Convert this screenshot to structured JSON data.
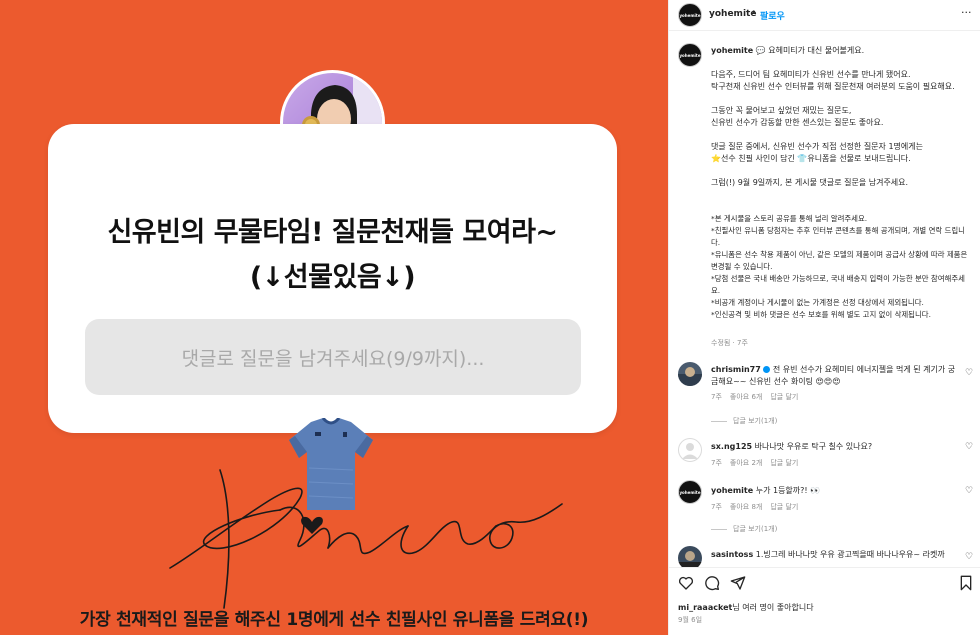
{
  "colors": {
    "background_orange": "#ec5a2e",
    "link_blue": "#0095f6",
    "muted": "#8e8e8e"
  },
  "image": {
    "card_title_line1": "신유빈의 무물타임! 질문천재들 모여라~",
    "card_title_line2": "(↓선물있음↓)",
    "card_input_placeholder": "댓글로 질문을 남겨주세요(9/9까지)...",
    "bottom_caption": "가장 천재적인 질문을 해주신 1명에게 선수 친필사인 유니폼을 드려요(!)"
  },
  "header": {
    "username": "yohemite",
    "separator": "•",
    "follow_label": "팔로우",
    "more_icon": "more-horizontal-icon",
    "more_label": "···"
  },
  "caption": {
    "username": "yohemite",
    "intro": "💬 요헤미티가 대신 물어볼게요.",
    "p1": "다음주, 드디어 팀 요헤미티가 신유빈 선수를 만나게 됐어요.\n탁구천재 신유빈 선수 인터뷰를 위해 질문천재 여러분의 도움이 필요해요.",
    "p2": "그동안 꼭 물어보고 싶었던 재밌는 질문도,\n신유빈 선수가 감동할 만한 센스있는 질문도 좋아요.",
    "p3": "댓글 질문 중에서, 신유빈 선수가 직접 선정한 질문자 1명에게는\n⭐선수 친필 사인이 담긴 👕유니폼을 선물로 보내드립니다.",
    "p4": "그럼(!) 9월 9일까지, 본 게시물 댓글로 질문을 남겨주세요.",
    "notes": "*본 게시물을 스토리 공유를 통해 널리 알려주세요.\n*친필사인 유니폼 당첨자는 추후 인터뷰 콘텐츠를 통해 공개되며, 개별 연락 드립니다.\n*유니폼은 선수 착용 제품이 아닌, 같은 모델의 제품이며 공급사 상황에 따라 제품은 변경될 수 있습니다.\n*당첨 선물은 국내 배송만 가능하므로, 국내 배송지 입력이 가능한 분만 참여해주세요.\n*비공개 계정이나 게시물이 없는 가계정은 선정 대상에서 제외됩니다.\n*인신공격 및 비하 댓글은 선수 보호를 위해 별도 고지 없이 삭제됩니다.",
    "meta": "수정됨 · 7주"
  },
  "comments": [
    {
      "username": "chrismin77",
      "verified": true,
      "text": "전 유빈 선수가 요헤미티 에너지젤을 먹게 된 계기가 궁금해요~~ 신유빈 선수 화이팅 😍😍😍",
      "time": "7주",
      "likes": "좋아요 6개",
      "reply": "답글 달기",
      "view_replies": "답글 보기(1개)"
    },
    {
      "username": "sx.ng125",
      "text": "바나나맛 우유로 탁구 칠수 있나요?",
      "time": "7주",
      "likes": "좋아요 2개",
      "reply": "답글 달기"
    },
    {
      "username": "yohemite",
      "text": "누가 1등할까?! 👀",
      "time": "7주",
      "likes": "좋아요 8개",
      "reply": "답글 달기",
      "view_replies": "답글 보기(1개)"
    },
    {
      "username": "sasintoss",
      "text": "1.빙그레 바나나맛 우유 광고찍을때 바나나우유~ 라켓까",
      "time": "",
      "likes": "",
      "reply": ""
    }
  ],
  "actions": {
    "icons": [
      "heart-icon",
      "comment-icon",
      "share-icon",
      "bookmark-icon"
    ],
    "likes_user": "mi_raaacket",
    "likes_suffix": "님 여러 명이 좋아합니다",
    "date": "9월 6일"
  }
}
